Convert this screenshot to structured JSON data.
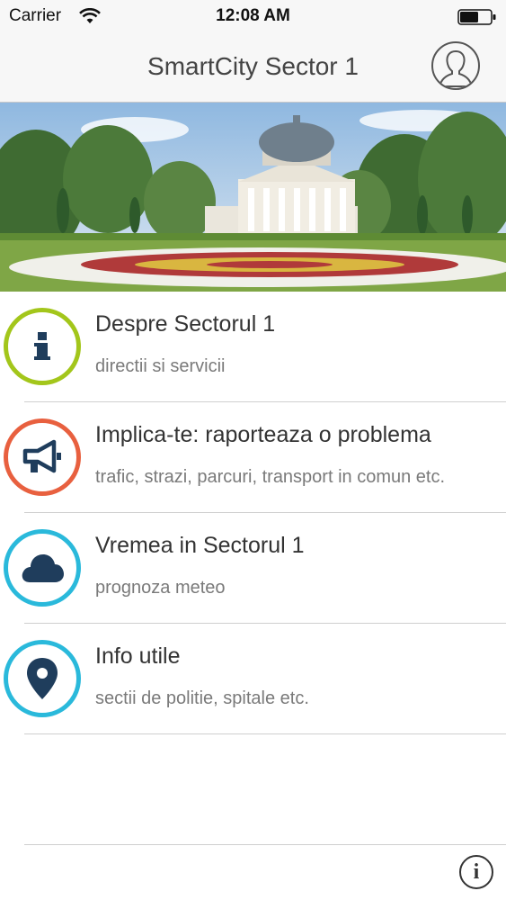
{
  "status_bar": {
    "carrier": "Carrier",
    "time": "12:08 AM",
    "wifi_icon": "wifi-icon",
    "battery_icon": "battery-icon"
  },
  "nav": {
    "title": "SmartCity Sector 1",
    "profile_icon": "user-profile-icon"
  },
  "banner": {
    "image": "romanian-athenaeum-photo"
  },
  "menu": [
    {
      "title": "Despre Sectorul 1",
      "subtitle": "directii si servicii",
      "icon": "info-icon",
      "ring_color": "#a3c61b",
      "icon_color": "#1f3d5c"
    },
    {
      "title": "Implica-te: raporteaza o problema",
      "subtitle": "trafic, strazi, parcuri, transport in comun etc.",
      "icon": "megaphone-icon",
      "ring_color": "#e8603f",
      "icon_color": "#1f3d5c"
    },
    {
      "title": "Vremea in Sectorul 1",
      "subtitle": "prognoza meteo",
      "icon": "cloud-icon",
      "ring_color": "#2ab9db",
      "icon_color": "#1f3d5c"
    },
    {
      "title": "Info utile",
      "subtitle": "sectii de politie, spitale etc.",
      "icon": "map-pin-icon",
      "ring_color": "#2ab9db",
      "icon_color": "#1f3d5c"
    }
  ],
  "footer": {
    "info_label": "i"
  }
}
